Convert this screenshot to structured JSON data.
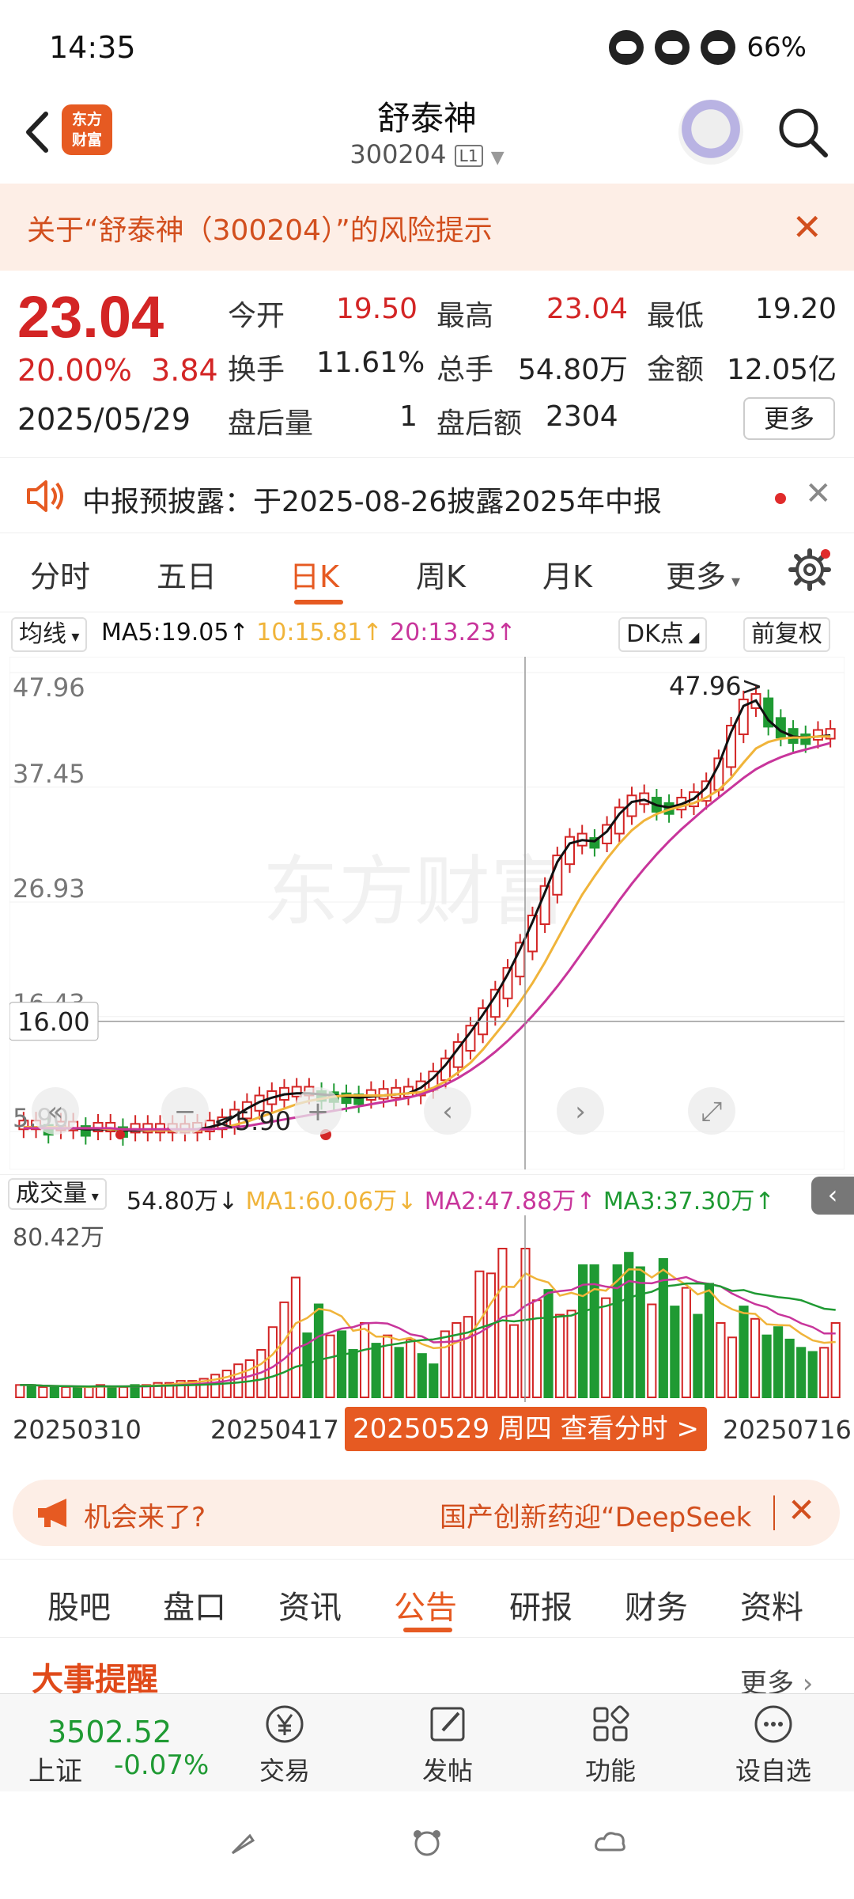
{
  "status": {
    "time": "14:35",
    "battery": "66%"
  },
  "header": {
    "logo_line1": "东方",
    "logo_line2": "财富",
    "title": "舒泰神",
    "code": "300204",
    "level": "L1"
  },
  "risk_banner": {
    "text": "关于“舒泰神（300204）”的风险提示"
  },
  "quote": {
    "price": "23.04",
    "change_pct": "20.00%",
    "change": "3.84",
    "date": "2025/05/29",
    "open_label": "今开",
    "open": "19.50",
    "high_label": "最高",
    "high": "23.04",
    "low_label": "最低",
    "low": "19.20",
    "turnover_label": "换手",
    "turnover": "11.61%",
    "volume_label": "总手",
    "volume": "54.80万",
    "amount_label": "金额",
    "amount": "12.05亿",
    "after_vol_label": "盘后量",
    "after_vol": "1",
    "after_amt_label": "盘后额",
    "after_amt": "2304",
    "more_label": "更多"
  },
  "notice": {
    "text": "中报预披露：于2025-08-26披露2025年中报"
  },
  "period_tabs": [
    "分时",
    "五日",
    "日K",
    "周K",
    "月K",
    "更多"
  ],
  "period_active": "日K",
  "ma_bar": {
    "type_label": "均线",
    "ma5": "MA5:19.05↑",
    "ma10": "10:15.81↑",
    "ma20": "20:13.23↑",
    "dk_label": "DK点",
    "adjust_label": "前复权"
  },
  "colors": {
    "up": "#d32525",
    "down": "#1f9a33",
    "ma5": "#111111",
    "ma10": "#f0b43a",
    "ma20": "#c8359b",
    "accent": "#e65a22"
  },
  "chart_data": {
    "type": "candlestick",
    "y_ticks": [
      "47.96",
      "37.45",
      "26.93",
      "16.43",
      "5.90"
    ],
    "ylim": [
      5.9,
      47.96
    ],
    "crosshair_value": "16.00",
    "max_label": "47.96",
    "min_label": "5.90",
    "watermark": "东方财富",
    "ma5": [
      6.3,
      6.3,
      6.2,
      6.2,
      6.2,
      6.1,
      6.1,
      6.1,
      6.0,
      6.0,
      6.0,
      6.0,
      6.0,
      6.0,
      6.1,
      6.3,
      6.6,
      7.3,
      8.0,
      8.6,
      9.0,
      9.3,
      9.4,
      9.4,
      9.3,
      9.2,
      9.1,
      9.0,
      9.1,
      9.2,
      9.3,
      9.4,
      9.9,
      10.8,
      12.0,
      13.5,
      15.0,
      16.6,
      18.3,
      20.3,
      22.6,
      25.1,
      27.8,
      30.6,
      32.3,
      32.6,
      32.5,
      33.4,
      35.0,
      36.1,
      36.3,
      35.8,
      35.6,
      35.9,
      36.4,
      37.4,
      39.5,
      42.5,
      44.9,
      45.4,
      43.6,
      42.6,
      42.1,
      42.0,
      42.1,
      42.2
    ],
    "ma10": [
      6.3,
      6.3,
      6.3,
      6.3,
      6.2,
      6.2,
      6.2,
      6.1,
      6.1,
      6.1,
      6.0,
      6.0,
      6.0,
      6.0,
      6.0,
      6.1,
      6.2,
      6.5,
      6.8,
      7.2,
      7.6,
      8.0,
      8.4,
      8.7,
      8.9,
      9.1,
      9.2,
      9.2,
      9.2,
      9.2,
      9.3,
      9.4,
      9.5,
      9.9,
      10.5,
      11.3,
      12.2,
      13.4,
      14.8,
      16.2,
      17.8,
      19.5,
      21.4,
      23.5,
      25.6,
      27.6,
      29.3,
      30.9,
      32.3,
      33.5,
      34.4,
      35.0,
      35.4,
      35.7,
      36.0,
      36.5,
      37.2,
      38.3,
      39.7,
      41.0,
      41.6,
      41.9,
      42.0,
      42.0,
      42.1,
      42.1
    ],
    "ma20": [
      6.2,
      6.2,
      6.2,
      6.2,
      6.2,
      6.2,
      6.2,
      6.2,
      6.1,
      6.1,
      6.1,
      6.1,
      6.1,
      6.1,
      6.1,
      6.1,
      6.2,
      6.3,
      6.4,
      6.6,
      6.8,
      7.0,
      7.2,
      7.4,
      7.6,
      7.8,
      8.0,
      8.2,
      8.4,
      8.6,
      8.8,
      9.0,
      9.3,
      9.7,
      10.2,
      10.8,
      11.5,
      12.3,
      13.2,
      14.2,
      15.3,
      16.5,
      17.8,
      19.2,
      20.7,
      22.3,
      23.9,
      25.5,
      27.1,
      28.6,
      30.0,
      31.3,
      32.5,
      33.6,
      34.6,
      35.6,
      36.5,
      37.4,
      38.3,
      39.1,
      39.7,
      40.2,
      40.6,
      40.9,
      41.2,
      41.5
    ],
    "volume": {
      "label": "成交量",
      "current": "54.80万↓",
      "ma1": "MA1:60.06万↓",
      "ma2": "MA2:47.88万↑",
      "ma3": "MA3:37.30万↑",
      "ymax_label": "80.42万",
      "values": [
        6,
        6,
        5,
        5,
        5,
        5,
        5,
        6,
        5,
        5,
        6,
        6,
        7,
        7,
        8,
        8,
        9,
        11,
        13,
        16,
        18,
        23,
        34,
        46,
        58,
        31,
        45,
        30,
        32,
        23,
        36,
        26,
        30,
        24,
        28,
        21,
        16,
        32,
        36,
        39,
        61,
        60,
        72,
        35,
        72,
        47,
        52,
        40,
        42,
        64,
        64,
        48,
        64,
        70,
        63,
        45,
        67,
        44,
        53,
        40,
        55,
        36,
        29,
        44,
        38,
        30,
        34,
        28,
        24,
        22,
        24,
        36
      ],
      "down": [
        false,
        true,
        false,
        true,
        false,
        true,
        false,
        false,
        true,
        false,
        true,
        false,
        false,
        false,
        false,
        false,
        false,
        false,
        false,
        false,
        false,
        false,
        false,
        false,
        false,
        true,
        true,
        false,
        true,
        true,
        false,
        true,
        false,
        true,
        false,
        true,
        true,
        false,
        false,
        false,
        false,
        false,
        false,
        false,
        false,
        false,
        true,
        false,
        false,
        true,
        true,
        false,
        true,
        true,
        true,
        false,
        true,
        true,
        false,
        true,
        true,
        false,
        false,
        true,
        false,
        true,
        true,
        true,
        true,
        true,
        false,
        false
      ]
    }
  },
  "date_axis": {
    "d1": "20250310",
    "d2": "20250417",
    "badge": "20250529 周四 查看分时 >",
    "d3": "20250716"
  },
  "promo": {
    "left": "机会来了?",
    "right": "国产创新药迎“DeepSeek"
  },
  "section_tabs": [
    "股吧",
    "盘口",
    "资讯",
    "公告",
    "研报",
    "财务",
    "资料"
  ],
  "section_active": "公告",
  "events": {
    "title": "大事提醒",
    "more": "更多"
  },
  "bottom_bar": {
    "index_value": "3502.52",
    "index_name": "上证",
    "index_change": "-0.07%",
    "trade": "交易",
    "post": "发帖",
    "features": "功能",
    "watchlist": "设自选"
  }
}
